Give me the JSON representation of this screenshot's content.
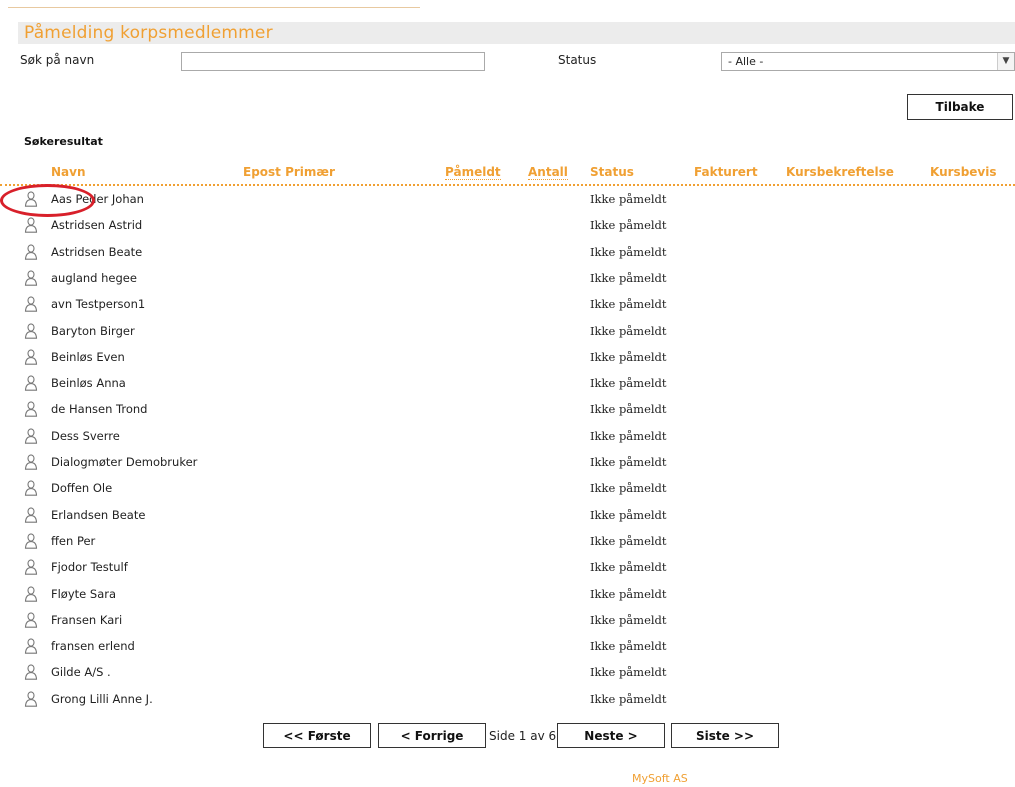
{
  "page": {
    "title": "Påmelding korpsmedlemmer"
  },
  "filters": {
    "name_label": "Søk på navn",
    "name_value": "",
    "status_label": "Status",
    "status_selected": "- Alle -"
  },
  "actions": {
    "back_label": "Tilbake"
  },
  "results": {
    "title": "Søkeresultat",
    "columns": [
      "Navn",
      "Epost Primær",
      "Påmeldt",
      "Antall",
      "Status",
      "Fakturert",
      "Kursbekreftelse",
      "Kursbevis"
    ],
    "rows": [
      {
        "name": "Aas Peder Johan",
        "status": "Ikke påmeldt"
      },
      {
        "name": "Astridsen Astrid",
        "status": "Ikke påmeldt"
      },
      {
        "name": "Astridsen Beate",
        "status": "Ikke påmeldt"
      },
      {
        "name": "augland hegee",
        "status": "Ikke påmeldt"
      },
      {
        "name": "avn Testperson1",
        "status": "Ikke påmeldt"
      },
      {
        "name": "Baryton Birger",
        "status": "Ikke påmeldt"
      },
      {
        "name": "Beinløs Even",
        "status": "Ikke påmeldt"
      },
      {
        "name": "Beinløs Anna",
        "status": "Ikke påmeldt"
      },
      {
        "name": "de Hansen Trond",
        "status": "Ikke påmeldt"
      },
      {
        "name": "Dess Sverre",
        "status": "Ikke påmeldt"
      },
      {
        "name": "Dialogmøter Demobruker",
        "status": "Ikke påmeldt"
      },
      {
        "name": "Doffen Ole",
        "status": "Ikke påmeldt"
      },
      {
        "name": "Erlandsen Beate",
        "status": "Ikke påmeldt"
      },
      {
        "name": "ffen Per",
        "status": "Ikke påmeldt"
      },
      {
        "name": "Fjodor Testulf",
        "status": "Ikke påmeldt"
      },
      {
        "name": "Fløyte Sara",
        "status": "Ikke påmeldt"
      },
      {
        "name": "Fransen Kari",
        "status": "Ikke påmeldt"
      },
      {
        "name": "fransen erlend",
        "status": "Ikke påmeldt"
      },
      {
        "name": "Gilde A/S .",
        "status": "Ikke påmeldt"
      },
      {
        "name": "Grong Lilli Anne J.",
        "status": "Ikke påmeldt"
      }
    ]
  },
  "pager": {
    "first": "<< Første",
    "prev": "< Forrige",
    "label": "Side 1 av 6",
    "next": "Neste >",
    "last": "Siste >>"
  },
  "footer": {
    "company": "MySoft AS"
  },
  "colors": {
    "accent": "#f0a033",
    "highlight": "#d8202a"
  },
  "icons": {
    "row_icon": "person-icon",
    "select_arrow": "chevron-down-icon"
  }
}
